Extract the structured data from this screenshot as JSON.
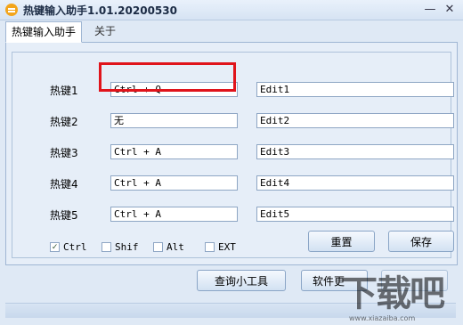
{
  "window": {
    "title": "热键输入助手1.01.20200530",
    "minimize_icon": "minimize-icon",
    "close_icon": "close-icon"
  },
  "tabs": [
    {
      "label": "热键输入助手",
      "active": true
    },
    {
      "label": "关于",
      "active": false
    }
  ],
  "hotkeys": [
    {
      "label": "热键1",
      "value": "Ctrl + Q",
      "edit": "Edit1",
      "highlighted": true
    },
    {
      "label": "热键2",
      "value": "无",
      "edit": "Edit2"
    },
    {
      "label": "热键3",
      "value": "Ctrl + A",
      "edit": "Edit3"
    },
    {
      "label": "热键4",
      "value": "Ctrl + A",
      "edit": "Edit4"
    },
    {
      "label": "热键5",
      "value": "Ctrl + A",
      "edit": "Edit5"
    }
  ],
  "modifiers": [
    {
      "label": "Ctrl",
      "checked": true
    },
    {
      "label": "Shif",
      "checked": false
    },
    {
      "label": "Alt",
      "checked": false
    },
    {
      "label": "EXT",
      "checked": false
    }
  ],
  "buttons": {
    "reset": "重置",
    "save": "保存",
    "query_tool": "查询小工具",
    "software_update": "软件更"
  },
  "watermark": {
    "text": "下载吧",
    "url": "www.xiazaiba.com"
  },
  "colors": {
    "highlight": "#e0141b",
    "accent_icon": "#f3a51c"
  }
}
